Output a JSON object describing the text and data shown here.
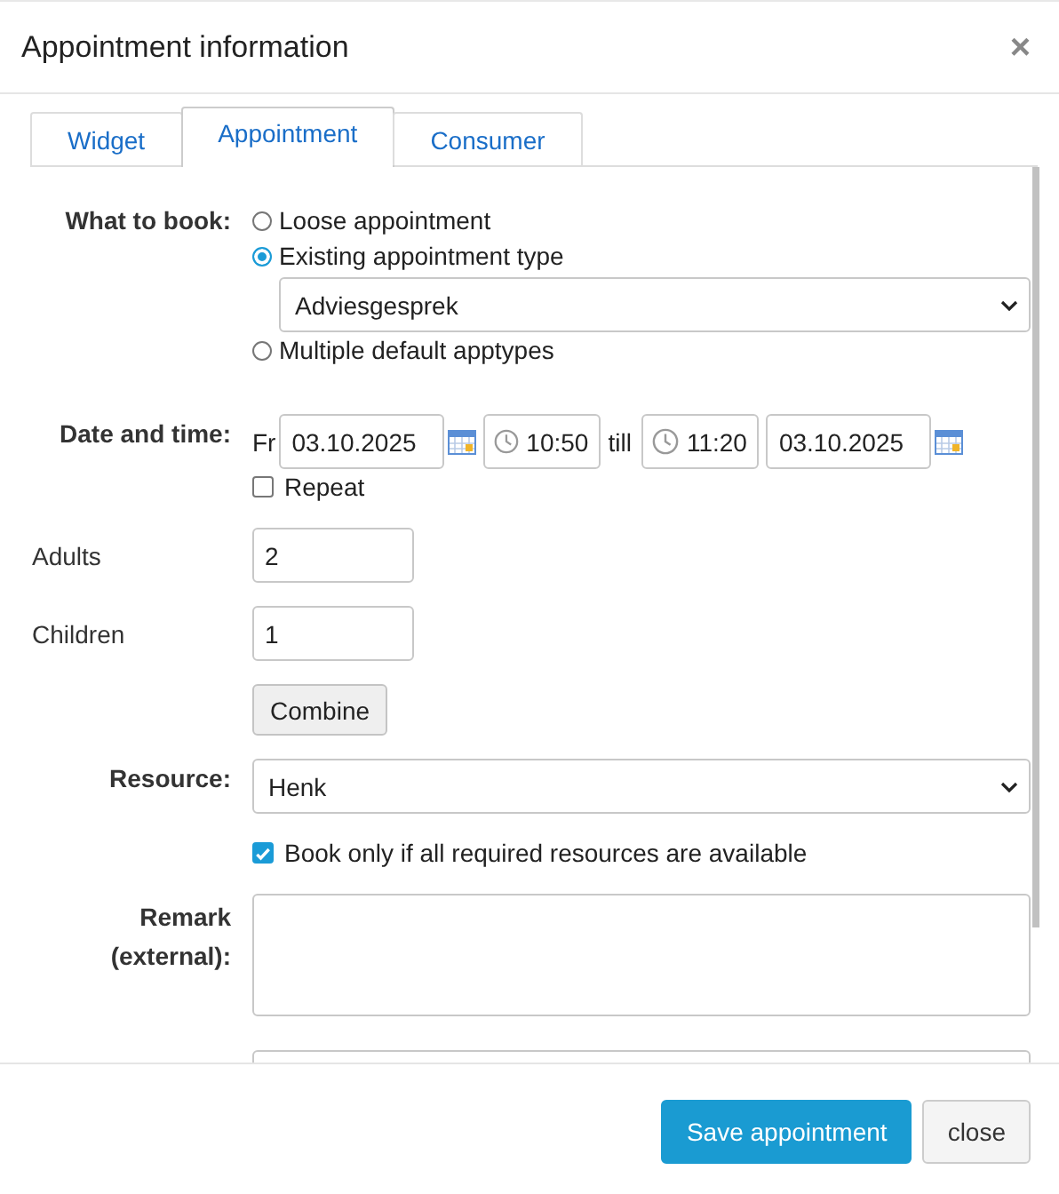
{
  "dialog": {
    "title": "Appointment information",
    "close": "×"
  },
  "tabs": [
    {
      "label": "Widget",
      "selected": false
    },
    {
      "label": "Appointment",
      "selected": true
    },
    {
      "label": "Consumer",
      "selected": false
    }
  ],
  "what_to_book": {
    "label": "What to book:",
    "options": [
      {
        "label": "Loose appointment",
        "selected": false
      },
      {
        "label": "Existing appointment type",
        "selected": true,
        "select_value": "Adviesgesprek"
      },
      {
        "label": "Multiple default apptypes",
        "selected": false
      }
    ]
  },
  "date_time": {
    "label": "Date and time:",
    "weekday": "Fr",
    "start_date": "03.10.2025",
    "start_time": "10:50",
    "separator": "till",
    "end_time": "11:20",
    "end_date": "03.10.2025",
    "repeat": {
      "label": "Repeat",
      "checked": false
    }
  },
  "adults": {
    "label": "Adults",
    "value": "2"
  },
  "children": {
    "label": "Children",
    "value": "1"
  },
  "combine_button": "Combine",
  "resource": {
    "label": "Resource:",
    "value": "Henk"
  },
  "availability": {
    "label": "Book only if all required resources are available",
    "checked": true
  },
  "remark": {
    "label": "Remark (external):"
  },
  "footer_buttons": [
    {
      "label": "Save appointment",
      "kind": "primary"
    },
    {
      "label": "close",
      "kind": "secondary"
    }
  ]
}
